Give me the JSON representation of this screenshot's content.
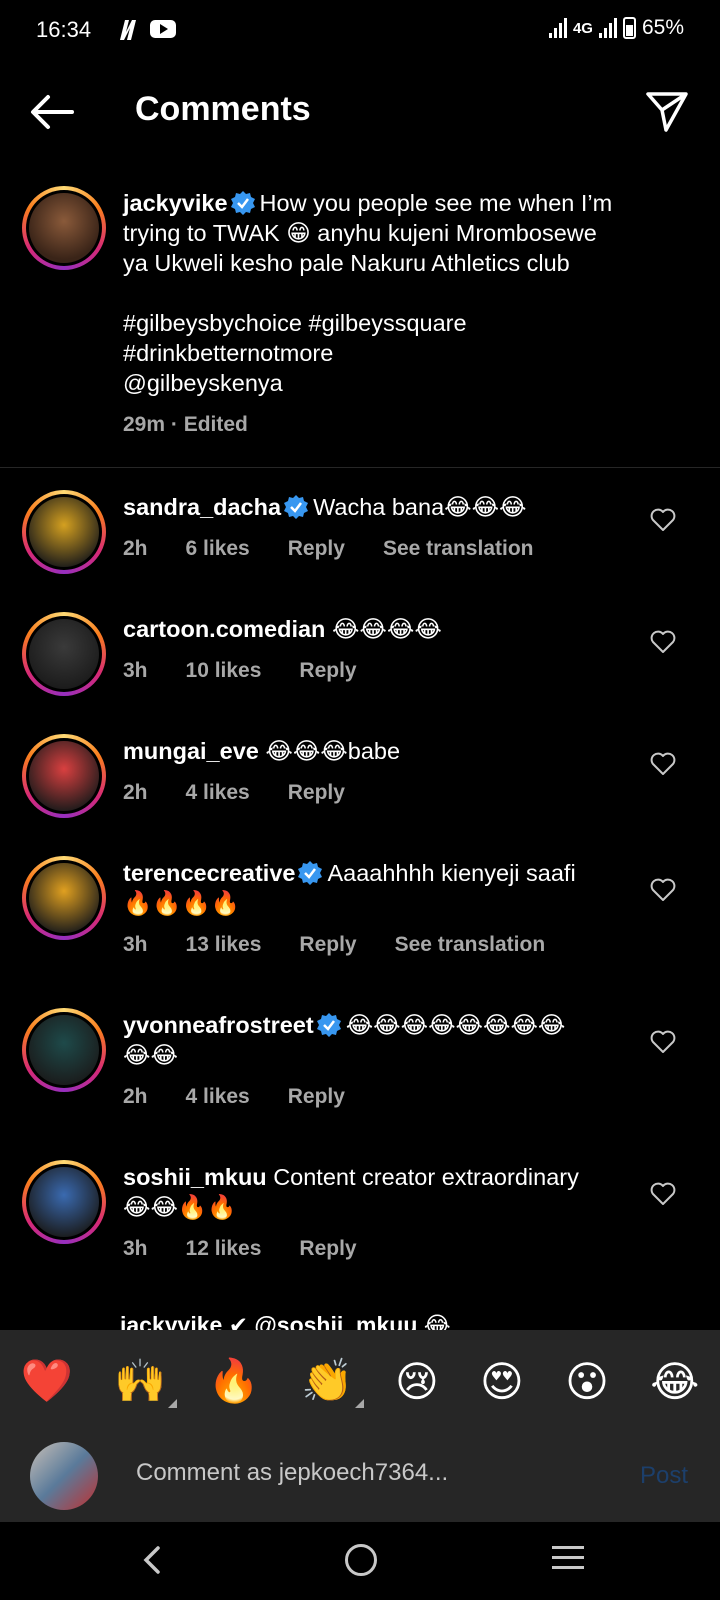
{
  "status": {
    "time": "16:34",
    "network": "4G",
    "battery": "65%"
  },
  "header": {
    "title": "Comments"
  },
  "caption": {
    "username": "jackyvike",
    "text_line1": "How you people see me when I’m",
    "text_line2": "trying to TWAK 😁 anyhu kujeni Mrombosewe",
    "text_line3": "ya Ukweli kesho pale Nakuru Athletics club",
    "hashtags_line1": "#gilbeysbychoice  #gilbeyssquare",
    "hashtags_line2": "#drinkbetternotmore",
    "mention": "@gilbeyskenya",
    "time": "29m",
    "edited": "Edited"
  },
  "comments": [
    {
      "username": "sandra_dacha",
      "verified": true,
      "text": "Wacha bana😂😂😂",
      "text2": "",
      "time": "2h",
      "likes": "6 likes",
      "reply": "Reply",
      "translate": "See translation",
      "avatar_color": "#d4a020"
    },
    {
      "username": "cartoon.comedian",
      "verified": false,
      "text": "😂😂😂😂",
      "text2": "",
      "time": "3h",
      "likes": "10 likes",
      "reply": "Reply",
      "translate": "",
      "avatar_color": "#3a3a3a"
    },
    {
      "username": "mungai_eve",
      "verified": false,
      "text": "😂😂😂babe",
      "text2": "",
      "time": "2h",
      "likes": "4 likes",
      "reply": "Reply",
      "translate": "",
      "avatar_color": "#d94040"
    },
    {
      "username": "terencecreative",
      "verified": true,
      "text": "Aaaahhhh kienyeji saafi",
      "text2": "🔥🔥🔥🔥",
      "time": "3h",
      "likes": "13 likes",
      "reply": "Reply",
      "translate": "See translation",
      "avatar_color": "#e0a020"
    },
    {
      "username": "yvonneafrostreet",
      "verified": true,
      "text": "😂😂😂😂😂😂😂😂",
      "text2": "😂😂",
      "time": "2h",
      "likes": "4 likes",
      "reply": "Reply",
      "translate": "",
      "avatar_color": "#1e4a4a"
    },
    {
      "username": "soshii_mkuu",
      "verified": false,
      "text": "Content creator extraordinary",
      "text2": "😂😂🔥🔥",
      "time": "3h",
      "likes": "12 likes",
      "reply": "Reply",
      "translate": "",
      "avatar_color": "#3a6ab0"
    }
  ],
  "peek_text": "jackyvike ✔ @soshii_mkuu 😂",
  "emoji_bar": [
    "❤️",
    "🙌",
    "🔥",
    "👏",
    "😢",
    "😍",
    "😮",
    "😂"
  ],
  "composer": {
    "placeholder": "Comment as jepkoech7364...",
    "post_label": "Post"
  }
}
